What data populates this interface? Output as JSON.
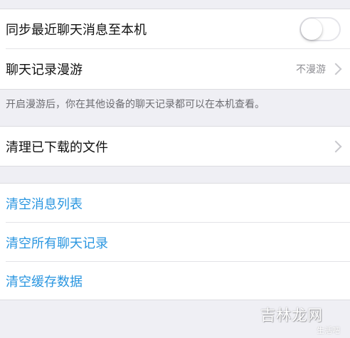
{
  "sync": {
    "label": "同步最近聊天消息至本机",
    "toggle_on": false
  },
  "roaming": {
    "label": "聊天记录漫游",
    "value": "不漫游",
    "footnote": "开启漫游后，你在其他设备的聊天记录都可以在本机查看。"
  },
  "downloads": {
    "label": "清理已下载的文件"
  },
  "actions": [
    {
      "label": "清空消息列表"
    },
    {
      "label": "清空所有聊天记录"
    },
    {
      "label": "清空缓存数据"
    }
  ],
  "watermark": {
    "text": "吉林龙网",
    "sub": "生活吧"
  },
  "colors": {
    "background": "#efeff4",
    "link_blue": "#2a96e0",
    "toggle_border": "#e5e5ea"
  }
}
